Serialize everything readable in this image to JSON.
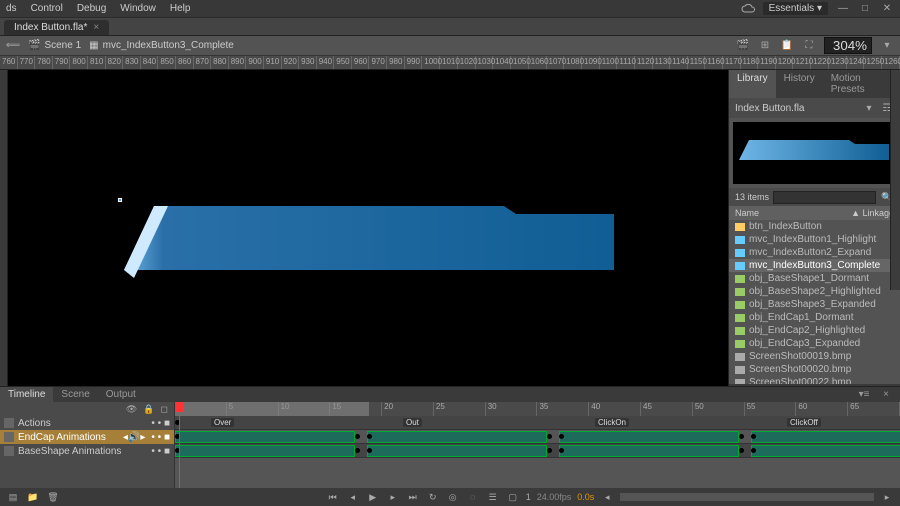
{
  "menu": {
    "items": [
      "ds",
      "Control",
      "Debug",
      "Window",
      "Help"
    ],
    "workspace": "Essentials"
  },
  "doc": {
    "tab": "Index Button.fla*"
  },
  "scene": {
    "back": "⟸",
    "scene": "Scene 1",
    "symbol": "mvc_IndexButton3_Complete",
    "zoom": "304%"
  },
  "ruler_top": [
    "760",
    "770",
    "780",
    "790",
    "800",
    "810",
    "820",
    "830",
    "840",
    "850",
    "860",
    "870",
    "880",
    "890",
    "900",
    "910",
    "920",
    "930",
    "940",
    "950",
    "960",
    "970",
    "980",
    "990",
    "1000",
    "1010",
    "1020",
    "1030",
    "1040",
    "1050",
    "1060",
    "1070",
    "1080",
    "1090",
    "1100",
    "1110",
    "1120",
    "1130",
    "1140",
    "1150",
    "1160",
    "1170",
    "1180",
    "1190",
    "1200",
    "1210",
    "1220",
    "1230",
    "1240",
    "1250",
    "1260"
  ],
  "library": {
    "tabs": [
      "Library",
      "History",
      "Motion Presets"
    ],
    "doc": "Index Button.fla",
    "count": "13 items",
    "cols": [
      "Name",
      "▲ Linkage"
    ],
    "items": [
      {
        "ico": "ico-btn",
        "label": "btn_IndexButton"
      },
      {
        "ico": "ico-mc",
        "label": "mvc_IndexButton1_Highlight"
      },
      {
        "ico": "ico-mc",
        "label": "mvc_IndexButton2_Expand"
      },
      {
        "ico": "ico-mc",
        "label": "mvc_IndexButton3_Complete",
        "sel": true
      },
      {
        "ico": "ico-gfx",
        "label": "obj_BaseShape1_Dormant"
      },
      {
        "ico": "ico-gfx",
        "label": "obj_BaseShape2_Highlighted"
      },
      {
        "ico": "ico-gfx",
        "label": "obj_BaseShape3_Expanded"
      },
      {
        "ico": "ico-gfx",
        "label": "obj_EndCap1_Dormant"
      },
      {
        "ico": "ico-gfx",
        "label": "obj_EndCap2_Highlighted"
      },
      {
        "ico": "ico-gfx",
        "label": "obj_EndCap3_Expanded"
      },
      {
        "ico": "ico-bmp",
        "label": "ScreenShot00019.bmp"
      },
      {
        "ico": "ico-bmp",
        "label": "ScreenShot00020.bmp"
      },
      {
        "ico": "ico-bmp",
        "label": "ScreenShot00022.bmp"
      }
    ]
  },
  "timeline": {
    "tabs": [
      "Timeline",
      "Scene",
      "Output"
    ],
    "frame_marks": [
      "1",
      "5",
      "10",
      "15",
      "20",
      "25",
      "30",
      "35",
      "40",
      "45",
      "50",
      "55",
      "60",
      "65"
    ],
    "layers": [
      {
        "name": "Actions",
        "sel": false
      },
      {
        "name": "EndCap Animations",
        "sel": true
      },
      {
        "name": "BaseShape Animations",
        "sel": false
      }
    ],
    "flags": [
      "Over",
      "Out",
      "ClickOn",
      "ClickOff"
    ],
    "foot": {
      "fps": "24.00fps",
      "time": "0.0s",
      "frame": "1"
    }
  },
  "chart_data": {
    "type": "timeline",
    "layers": [
      {
        "name": "Actions",
        "keyframes": [
          1
        ]
      },
      {
        "name": "EndCap Animations",
        "segments": [
          {
            "from": 1,
            "to": 16,
            "label": "Over"
          },
          {
            "from": 17,
            "to": 32,
            "label": "Out"
          },
          {
            "from": 33,
            "to": 48,
            "label": "ClickOn"
          },
          {
            "from": 49,
            "to": 64,
            "label": "ClickOff"
          }
        ]
      },
      {
        "name": "BaseShape Animations",
        "segments": [
          {
            "from": 1,
            "to": 16
          },
          {
            "from": 17,
            "to": 32
          },
          {
            "from": 33,
            "to": 48
          },
          {
            "from": 49,
            "to": 64
          }
        ]
      }
    ],
    "playhead": 1,
    "loop_range": [
      1,
      16
    ]
  }
}
